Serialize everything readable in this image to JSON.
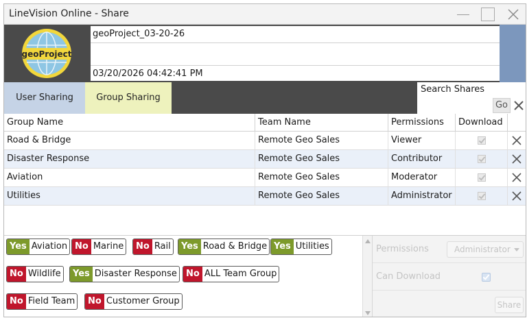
{
  "window": {
    "title": "LineVision Online - Share"
  },
  "logo": {
    "text": "geoProject"
  },
  "project": {
    "name": "geoProject_03-20-26",
    "description": "",
    "timestamp": "03/20/2026 04:42:41 PM"
  },
  "tabs": [
    {
      "label": "User Sharing",
      "active": false
    },
    {
      "label": "Group Sharing",
      "active": true
    }
  ],
  "search": {
    "label": "Search Shares",
    "value": "",
    "go_label": "Go"
  },
  "table": {
    "headers": [
      "Group Name",
      "Team Name",
      "Permissions",
      "Download"
    ],
    "rows": [
      {
        "group": "Road & Bridge",
        "team": "Remote Geo Sales",
        "permission": "Viewer",
        "download": true
      },
      {
        "group": "Disaster Response",
        "team": "Remote Geo Sales",
        "permission": "Contributor",
        "download": true
      },
      {
        "group": "Aviation",
        "team": "Remote Geo Sales",
        "permission": "Moderator",
        "download": true
      },
      {
        "group": "Utilities",
        "team": "Remote Geo Sales",
        "permission": "Administrator",
        "download": true
      }
    ]
  },
  "tags": [
    {
      "state": "Yes",
      "label": "Aviation"
    },
    {
      "state": "No",
      "label": "Marine"
    },
    {
      "state": "No",
      "label": "Rail"
    },
    {
      "state": "Yes",
      "label": "Road & Bridge"
    },
    {
      "state": "Yes",
      "label": "Utilities"
    },
    {
      "state": "No",
      "label": "Wildlife"
    },
    {
      "state": "Yes",
      "label": "Disaster Response"
    },
    {
      "state": "No",
      "label": "ALL Team Group"
    },
    {
      "state": "No",
      "label": "Field Team"
    },
    {
      "state": "No",
      "label": "Customer Group"
    }
  ],
  "properties": {
    "permissions_label": "Permissions",
    "permissions_value": "Administrator",
    "can_download_label": "Can Download",
    "can_download": true,
    "share_label": "Share"
  },
  "colors": {
    "header_bg": "#4a4a4a",
    "user_tab": "#c5d3e6",
    "group_tab": "#eef2bd",
    "yes": "#7d9a2b",
    "no": "#c0162c",
    "accent_blue": "#7c97bd"
  }
}
